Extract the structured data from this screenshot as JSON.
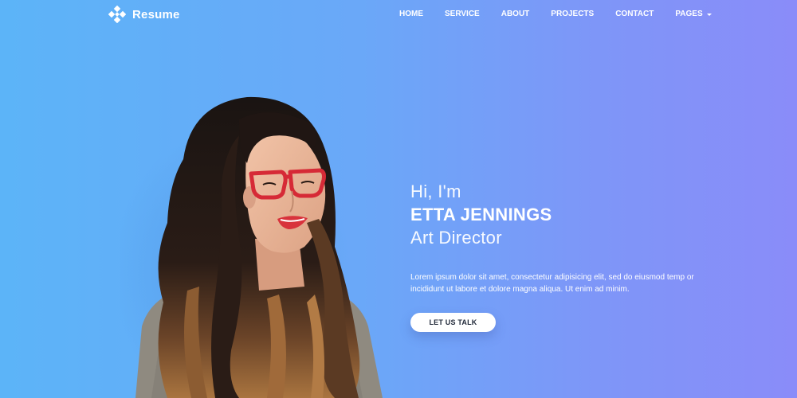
{
  "brand": {
    "name": "Resume"
  },
  "nav": {
    "items": [
      {
        "label": "HOME"
      },
      {
        "label": "SERVICE"
      },
      {
        "label": "ABOUT"
      },
      {
        "label": "PROJECTS"
      },
      {
        "label": "CONTACT"
      },
      {
        "label": "PAGES"
      }
    ]
  },
  "hero": {
    "greeting": "Hi, I'm",
    "name": "ETTA JENNINGS",
    "role": "Art Director",
    "description": "Lorem ipsum dolor sit amet, consectetur adipisicing elit, sed do eiusmod temp or incididunt ut labore et dolore magna aliqua. Ut enim ad minim.",
    "cta_label": "LET US TALK"
  },
  "colors": {
    "gradient_start": "#5cb4f8",
    "gradient_end": "#8a8cf9",
    "glasses": "#d62a36"
  },
  "icons": {
    "logo": "diamond-cluster-icon",
    "pages_dropdown": "caret-down-icon"
  }
}
